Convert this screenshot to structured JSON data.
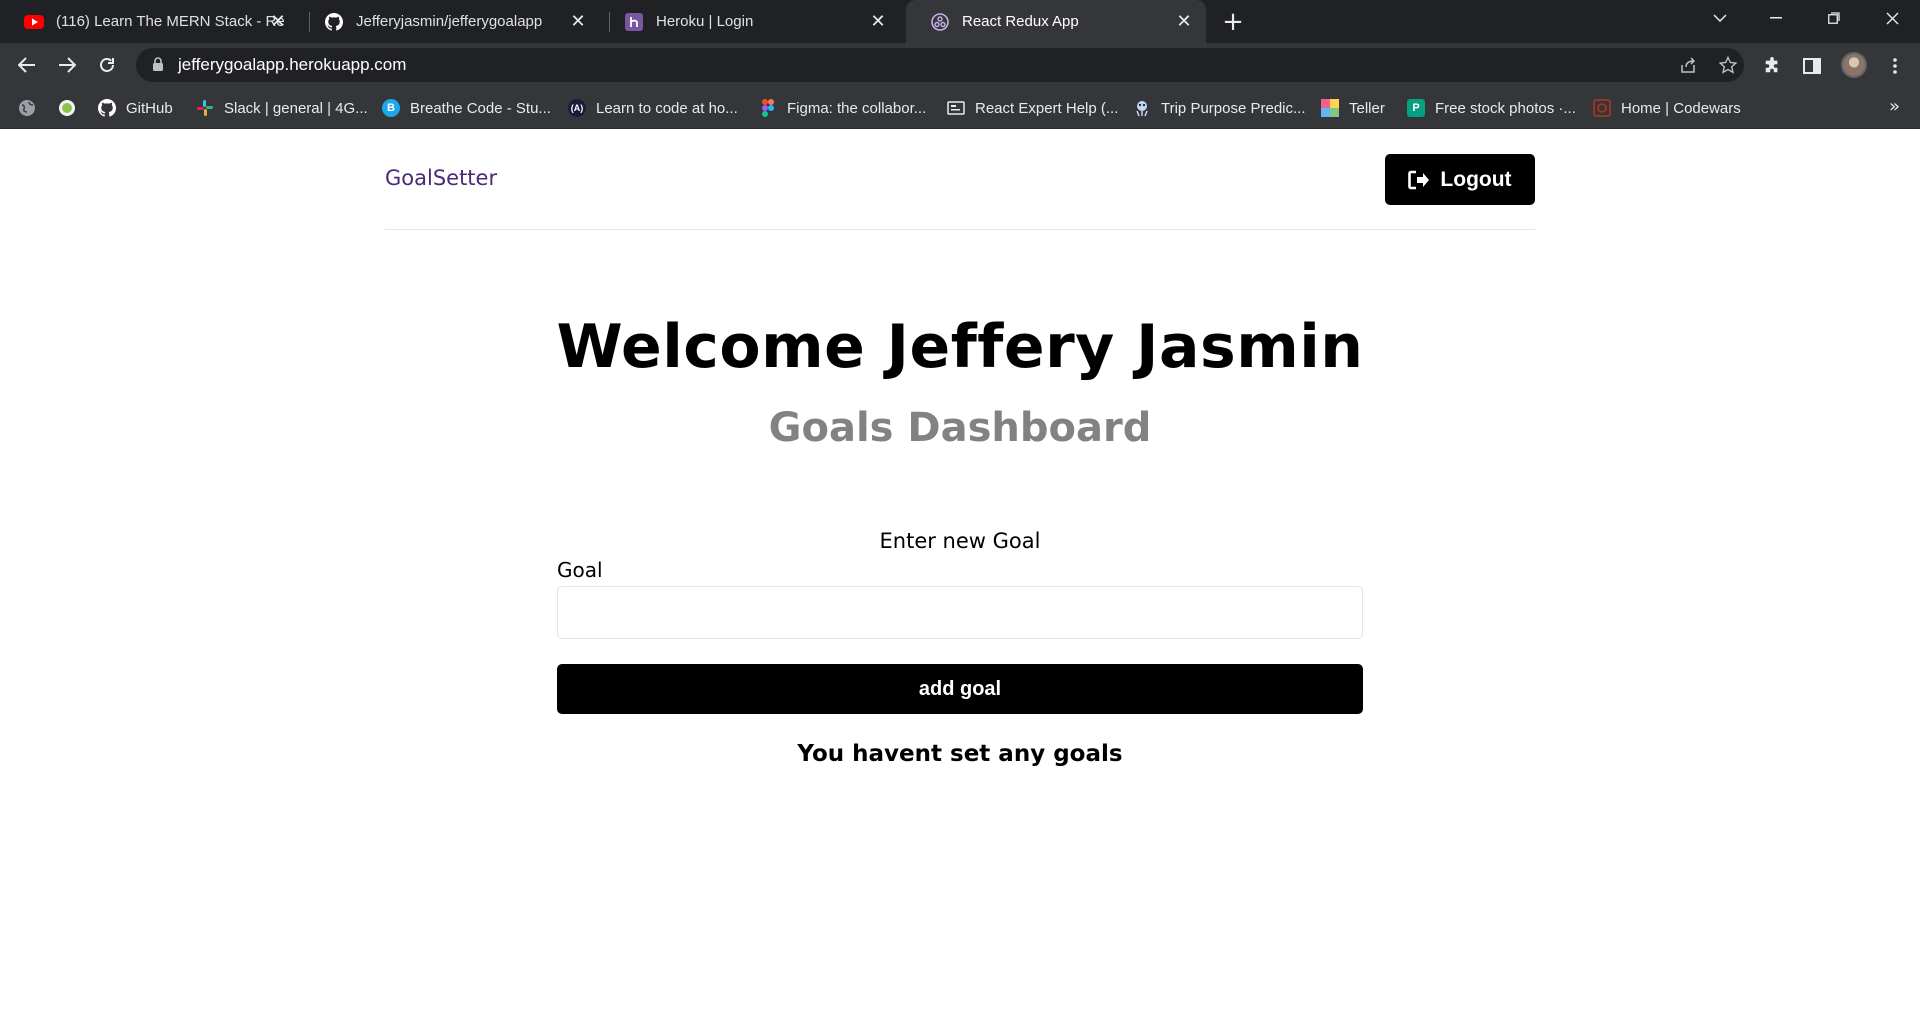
{
  "browser": {
    "tabs": [
      {
        "title": "(116) Learn The MERN Stack - Re",
        "favicon": "youtube-icon"
      },
      {
        "title": "Jefferyjasmin/jefferygoalapp",
        "favicon": "github-icon"
      },
      {
        "title": "Heroku | Login",
        "favicon": "heroku-icon"
      },
      {
        "title": "React Redux App",
        "favicon": "redux-icon",
        "active": true
      }
    ],
    "url": "jefferygoalapp.herokuapp.com",
    "bookmarks": [
      {
        "label": "",
        "icon": "globe-icon"
      },
      {
        "label": "",
        "icon": "extension-badge-icon"
      },
      {
        "label": "GitHub",
        "icon": "github-icon"
      },
      {
        "label": "Slack | general | 4G...",
        "icon": "slack-icon"
      },
      {
        "label": "Breathe Code - Stu...",
        "icon": "breathe-code-icon"
      },
      {
        "label": "Learn to code at ho...",
        "icon": "code-icon"
      },
      {
        "label": "Figma: the collabor...",
        "icon": "figma-icon"
      },
      {
        "label": "React Expert Help (...",
        "icon": "react-help-icon"
      },
      {
        "label": "Trip Purpose Predic...",
        "icon": "trip-icon"
      },
      {
        "label": "Teller",
        "icon": "teller-icon"
      },
      {
        "label": "Free stock photos ·...",
        "icon": "pexels-icon"
      },
      {
        "label": "Home | Codewars",
        "icon": "codewars-icon"
      }
    ]
  },
  "app": {
    "brand": "GoalSetter",
    "logout_label": "Logout",
    "welcome": "Welcome Jeffery Jasmin",
    "subtitle": "Goals Dashboard",
    "form": {
      "heading": "Enter new Goal",
      "goal_label": "Goal",
      "goal_value": "",
      "submit_label": "add goal"
    },
    "empty_message": "You havent set any goals"
  },
  "colors": {
    "brand": "#4a2a7a",
    "button_bg": "#000000",
    "subtitle": "#828282",
    "chrome_dark": "#202124",
    "chrome_toolbar": "#35363a"
  }
}
